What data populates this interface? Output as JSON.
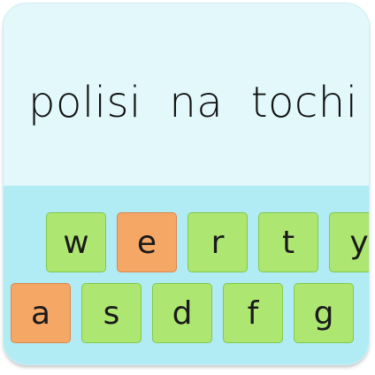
{
  "phrase": "polisi  na  tochi",
  "keyboard": {
    "row1": [
      {
        "label": "w",
        "highlighted": false
      },
      {
        "label": "e",
        "highlighted": true
      },
      {
        "label": "r",
        "highlighted": false
      },
      {
        "label": "t",
        "highlighted": false
      },
      {
        "label": "y",
        "highlighted": false
      }
    ],
    "row2": [
      {
        "label": "a",
        "highlighted": true
      },
      {
        "label": "s",
        "highlighted": false
      },
      {
        "label": "d",
        "highlighted": false
      },
      {
        "label": "f",
        "highlighted": false
      },
      {
        "label": "g",
        "highlighted": false
      }
    ]
  },
  "colors": {
    "text_area_bg": "#e2f8fb",
    "keyboard_bg": "#b1ecf5",
    "key_default": "#aee672",
    "key_highlight": "#f5a766"
  }
}
